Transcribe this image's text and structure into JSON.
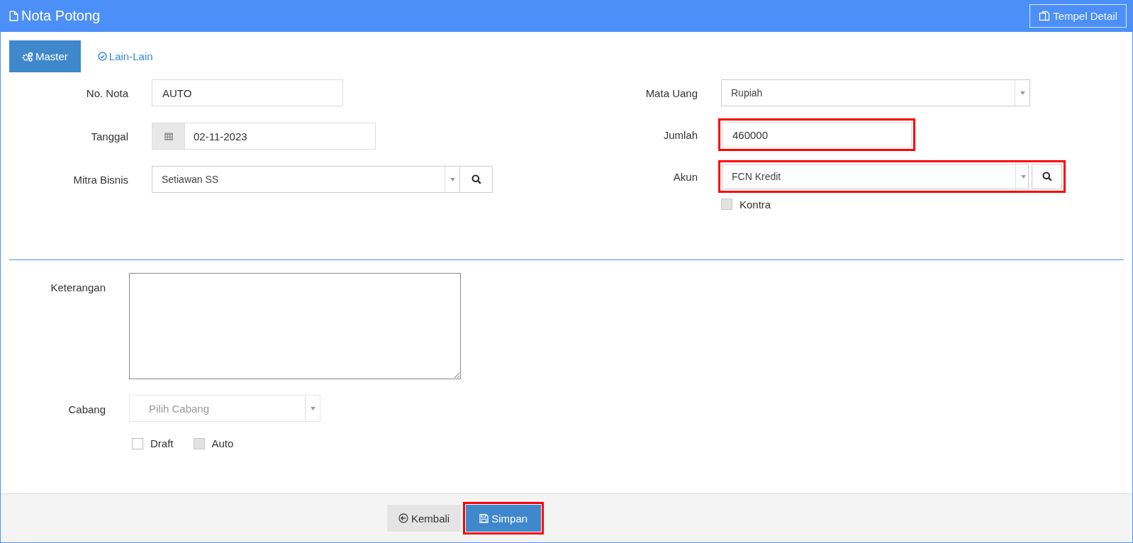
{
  "header": {
    "title": "Nota Potong",
    "action": "Tempel Detail"
  },
  "tabs": [
    {
      "label": "Master",
      "selected": true
    },
    {
      "label": "Lain-Lain",
      "selected": false
    }
  ],
  "columns": [
    {
      "fields": [
        {
          "label": "No. Nota",
          "kind": "text",
          "value": "AUTO",
          "highlighted": false
        },
        {
          "label": "Tanggal",
          "kind": "date",
          "value": "02-11-2023",
          "highlighted": false
        },
        {
          "label": "Mitra Bisnis",
          "kind": "lookup",
          "value": "Setiawan SS",
          "highlighted": false
        }
      ]
    },
    {
      "fields": [
        {
          "label": "Mata Uang",
          "kind": "select",
          "value": "Rupiah",
          "highlighted": false
        },
        {
          "label": "Jumlah",
          "kind": "number",
          "value": "460000",
          "highlighted": true
        },
        {
          "label": "Akun",
          "kind": "lookup",
          "value": "FCN Kredit",
          "highlighted": true
        },
        {
          "kind": "checkbox",
          "label": "Kontra",
          "checked": false,
          "disabled": true
        }
      ]
    }
  ],
  "notes": {
    "label": "Keterangan"
  },
  "branch": {
    "label": "Cabang",
    "placeholder": "Pilih Cabang"
  },
  "options": [
    {
      "label": "Draft",
      "checked": false,
      "disabled": false
    },
    {
      "label": "Auto",
      "checked": false,
      "disabled": true
    }
  ],
  "buttons": [
    {
      "label": "Kembali",
      "kind": "back",
      "highlighted": false
    },
    {
      "label": "Simpan",
      "kind": "save",
      "highlighted": true
    }
  ]
}
